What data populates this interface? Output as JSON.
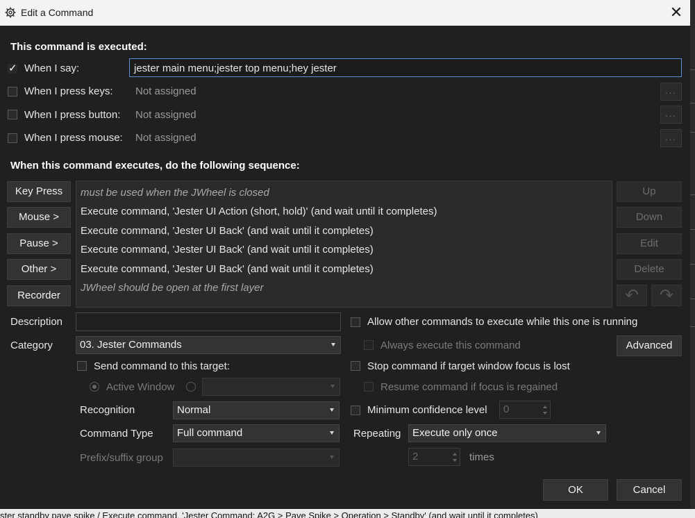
{
  "window": {
    "title": "Edit a Command",
    "close_icon": "close-icon",
    "app_icon": "gear-icon"
  },
  "triggers": {
    "heading": "This command is executed:",
    "when_i_say": {
      "label": "When I say:",
      "checked": true,
      "value": "jester main menu;jester top menu;hey jester"
    },
    "press_keys": {
      "label": "When I press keys:",
      "checked": false,
      "value": "Not assigned",
      "button": "..."
    },
    "press_button": {
      "label": "When I press button:",
      "checked": false,
      "value": "Not assigned",
      "button": "..."
    },
    "press_mouse": {
      "label": "When I press mouse:",
      "checked": false,
      "value": "Not assigned",
      "button": "..."
    }
  },
  "sequence": {
    "heading": "When this command executes, do the following sequence:",
    "left_buttons": [
      "Key Press",
      "Mouse >",
      "Pause >",
      "Other >",
      "Recorder"
    ],
    "rows": [
      {
        "text": "must be used when the JWheel is closed",
        "italic": true
      },
      {
        "text": "Execute command, 'Jester UI Action (short, hold)' (and wait until it completes)",
        "italic": false
      },
      {
        "text": "Execute command, 'Jester UI Back' (and wait until it completes)",
        "italic": false
      },
      {
        "text": "Execute command, 'Jester UI Back' (and wait until it completes)",
        "italic": false
      },
      {
        "text": "Execute command, 'Jester UI Back' (and wait until it completes)",
        "italic": false
      },
      {
        "text": "JWheel should be open at the first layer",
        "italic": true
      }
    ],
    "right_buttons": [
      "Up",
      "Down",
      "Edit",
      "Delete"
    ],
    "undo_icon": "undo-icon",
    "redo_icon": "redo-icon"
  },
  "options": {
    "description_label": "Description",
    "description_value": "",
    "category_label": "Category",
    "category_value": "03. Jester Commands",
    "send_to_target": "Send command to this target:",
    "active_window": "Active Window",
    "recognition_label": "Recognition",
    "recognition_value": "Normal",
    "command_type_label": "Command Type",
    "command_type_value": "Full command",
    "prefix_suffix_label": "Prefix/suffix group",
    "prefix_suffix_value": "",
    "allow_other": "Allow other commands to execute while this one is running",
    "always_execute": "Always execute this command",
    "advanced": "Advanced",
    "stop_on_focus": "Stop command if target window focus is lost",
    "resume_on_focus": "Resume command if focus is regained",
    "min_confidence": "Minimum confidence level",
    "min_confidence_value": "0",
    "repeating_label": "Repeating",
    "repeating_value": "Execute only once",
    "times_value": "2",
    "times_label": "times"
  },
  "footer": {
    "ok": "OK",
    "cancel": "Cancel"
  },
  "background_text": "ster standby pave spike /  Execute command, 'Jester Command: A2G > Pave Spike > Operation > Standby' (and wait until it completes)"
}
